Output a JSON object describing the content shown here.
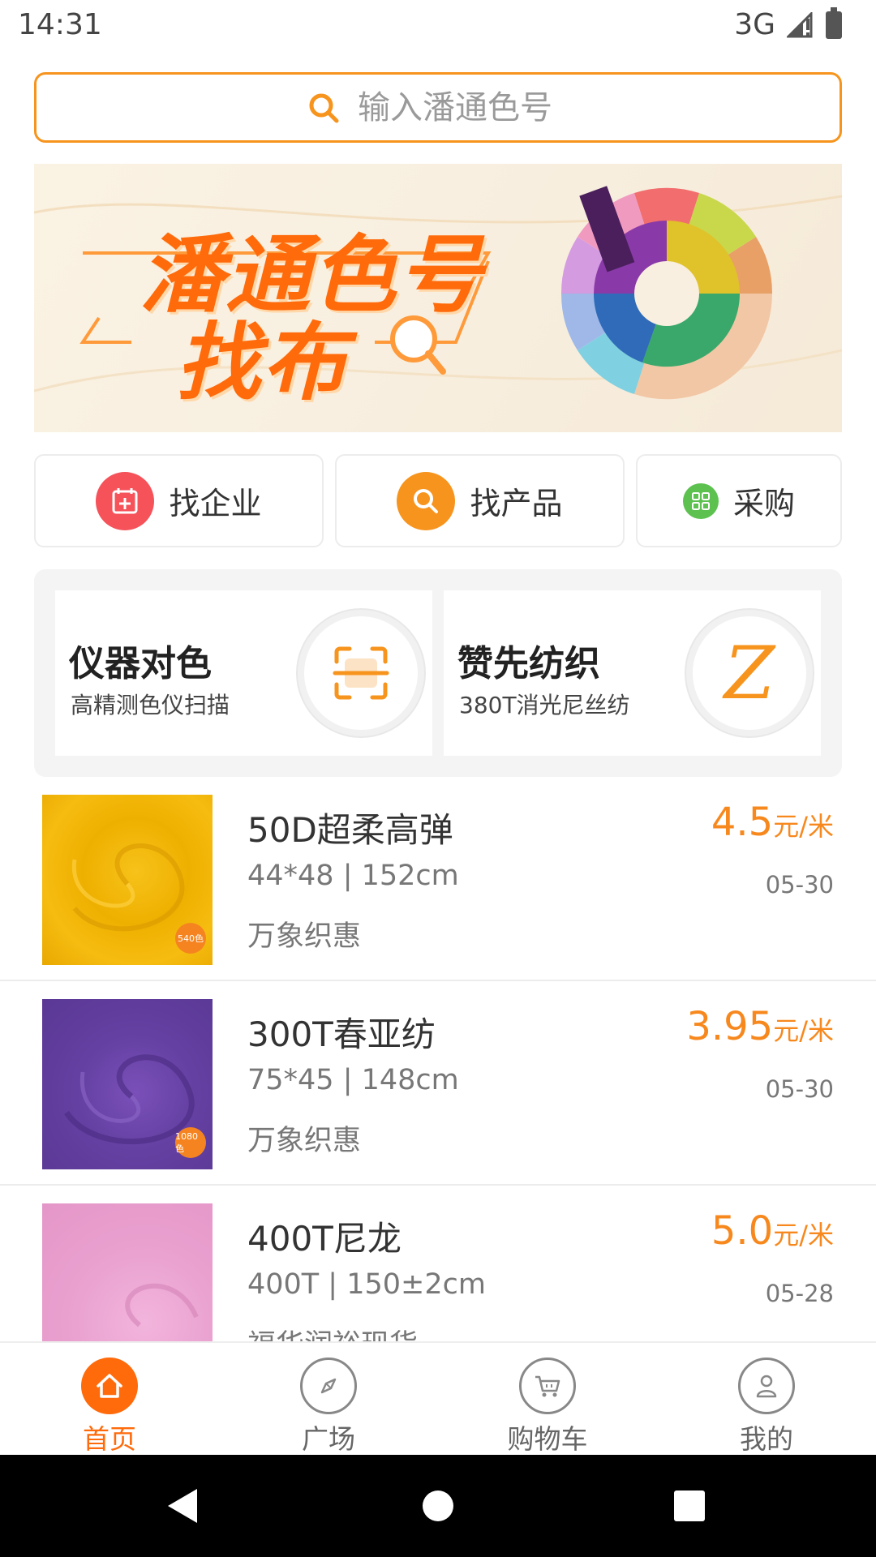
{
  "status_bar": {
    "time": "14:31",
    "network": "3G"
  },
  "search": {
    "placeholder": "输入潘通色号"
  },
  "banner": {
    "line1": "潘通色号",
    "line2": "找布"
  },
  "quick_actions": [
    {
      "label": "找企业",
      "icon": "calendar-plus-icon",
      "color": "#f5525a"
    },
    {
      "label": "找产品",
      "icon": "search-icon",
      "color": "#f7941d"
    },
    {
      "label": "采购",
      "icon": "grid-icon",
      "color": "#5cc14f"
    }
  ],
  "features": [
    {
      "title": "仪器对色",
      "subtitle": "高精测色仪扫描",
      "icon": "scan-icon"
    },
    {
      "title": "赞先纺织",
      "subtitle": "380T消光尼丝纺",
      "icon": "z-logo-icon",
      "badge_letter": "Z"
    }
  ],
  "products": [
    {
      "name": "50D超柔高弹",
      "spec": "44*48 | 152cm",
      "seller": "万象织惠",
      "price": "4.5",
      "unit": "元/米",
      "date": "05-30",
      "color": "#f3b608",
      "tag": "540色"
    },
    {
      "name": "300T春亚纺",
      "spec": "75*45 | 148cm",
      "seller": "万象织惠",
      "price": "3.95",
      "unit": "元/米",
      "date": "05-30",
      "color": "#6a44a6",
      "tag": "1080色"
    },
    {
      "name": "400T尼龙",
      "spec": "400T | 150±2cm",
      "seller": "福华润裕现货",
      "price": "5.0",
      "unit": "元/米",
      "date": "05-28",
      "color": "#eca3d1",
      "tag": ""
    }
  ],
  "bottom_nav": [
    {
      "label": "首页",
      "icon": "home-icon",
      "active": true
    },
    {
      "label": "广场",
      "icon": "compass-icon",
      "active": false
    },
    {
      "label": "购物车",
      "icon": "cart-icon",
      "active": false
    },
    {
      "label": "我的",
      "icon": "user-icon",
      "active": false
    }
  ],
  "colors": {
    "accent": "#f7941d",
    "active": "#ff6a0a",
    "price": "#f7881d"
  }
}
